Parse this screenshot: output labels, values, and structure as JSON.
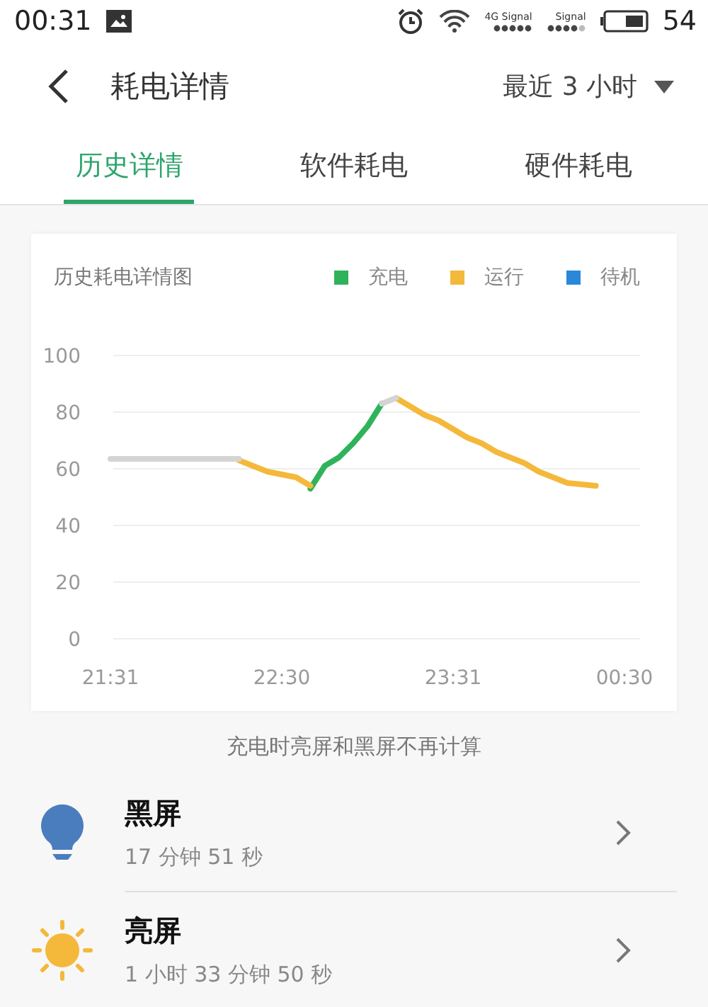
{
  "status_bar": {
    "time": "00:31",
    "sim1_label": "4G Signal",
    "sim2_label": "Signal",
    "battery": "54"
  },
  "header": {
    "title": "耗电详情",
    "range": "最近 3 小时"
  },
  "tabs": [
    {
      "label": "历史详情",
      "selected": true
    },
    {
      "label": "软件耗电",
      "selected": false
    },
    {
      "label": "硬件耗电",
      "selected": false
    }
  ],
  "card": {
    "title": "历史耗电详情图",
    "chart_data": {
      "type": "line",
      "categories": [
        "21:31",
        null,
        null,
        null,
        null,
        null,
        null,
        null,
        null,
        null,
        null,
        null,
        "22:30",
        null,
        null,
        null,
        null,
        null,
        null,
        null,
        null,
        null,
        null,
        null,
        "23:31",
        null,
        null,
        null,
        null,
        null,
        null,
        null,
        null,
        null,
        null,
        null,
        "00:30"
      ],
      "series": [
        {
          "name": "充电",
          "color": "#2fb35a",
          "values": [
            null,
            null,
            null,
            null,
            null,
            null,
            null,
            null,
            null,
            null,
            null,
            null,
            null,
            null,
            53,
            61,
            64,
            69,
            75,
            83,
            null,
            null,
            null,
            null,
            null,
            null,
            null,
            null,
            null,
            null,
            null,
            null,
            null,
            null,
            null,
            null,
            null
          ]
        },
        {
          "name": "运行",
          "color": "#f4b83a",
          "values": [
            null,
            null,
            null,
            null,
            null,
            null,
            null,
            null,
            null,
            63,
            61,
            59,
            58,
            57,
            54,
            null,
            null,
            null,
            null,
            null,
            85,
            82,
            79,
            77,
            74,
            71,
            69,
            66,
            64,
            62,
            59,
            57,
            55,
            54.5,
            54,
            null,
            null
          ]
        },
        {
          "name": "待机",
          "color": "#2a88d8",
          "values": [
            null,
            null,
            null,
            null,
            null,
            null,
            null,
            null,
            null,
            null,
            null,
            null,
            null,
            null,
            null,
            null,
            null,
            null,
            null,
            null,
            null,
            null,
            null,
            null,
            null,
            null,
            null,
            null,
            null,
            null,
            null,
            null,
            null,
            null,
            null,
            null,
            null
          ]
        },
        {
          "color": "#d4d4d4",
          "values": [
            63.5,
            63.5,
            63.5,
            63.5,
            63.5,
            63.5,
            63.5,
            63.5,
            63.5,
            63.5,
            null,
            null,
            null,
            null,
            null,
            null,
            null,
            null,
            null,
            83,
            85,
            null,
            null,
            null,
            null,
            null,
            null,
            null,
            null,
            null,
            null,
            null,
            null,
            null,
            null,
            null,
            null
          ]
        }
      ],
      "ylim": [
        0,
        100
      ],
      "yticks": [
        0,
        20,
        40,
        60,
        80,
        100
      ],
      "grid": true
    }
  },
  "note": "充电时亮屏和黑屏不再计算",
  "items": [
    {
      "kind": "dark",
      "title": "黑屏",
      "detail": "17 分钟 51 秒"
    },
    {
      "kind": "bright",
      "title": "亮屏",
      "detail": "1 小时 33 分钟 50 秒"
    }
  ]
}
